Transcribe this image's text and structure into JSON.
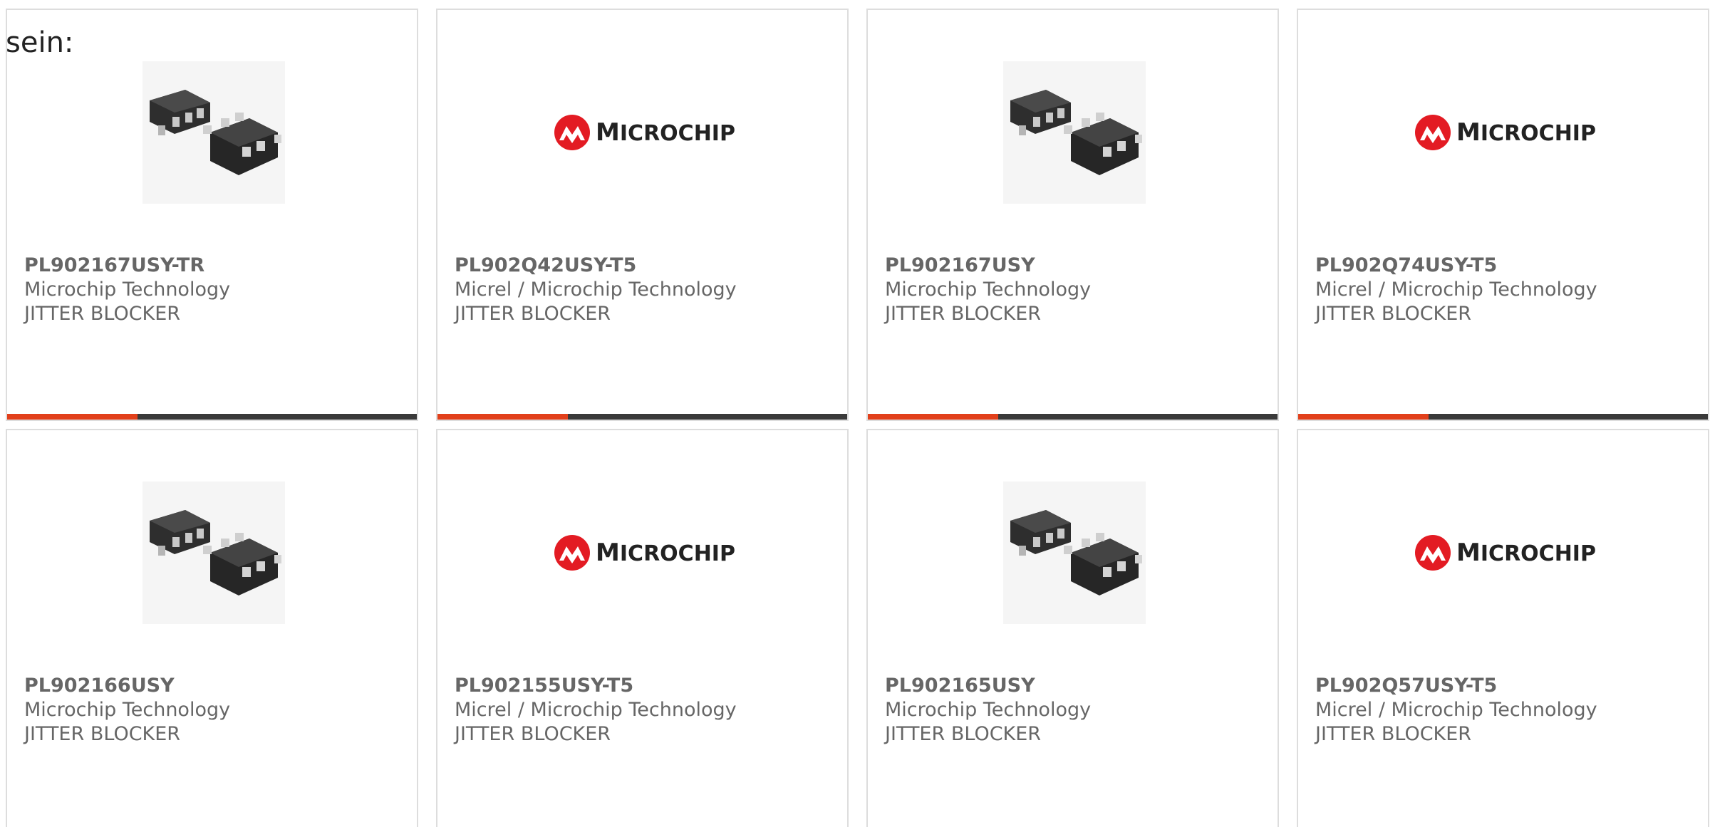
{
  "intro_text": "sein:",
  "colors": {
    "accent": "#e2401b",
    "bar": "#3a3a3a",
    "text": "#666666",
    "border": "#dddddd",
    "logo_red": "#e31b23"
  },
  "cards": [
    {
      "part": "PL902167USY-TR",
      "manufacturer": "Microchip Technology",
      "description": "JITTER BLOCKER",
      "image": "chip-photo"
    },
    {
      "part": "PL902Q42USY-T5",
      "manufacturer": "Micrel / Microchip Technology",
      "description": "JITTER BLOCKER",
      "image": "microchip-logo",
      "logo_text": "Microchip"
    },
    {
      "part": "PL902167USY",
      "manufacturer": "Microchip Technology",
      "description": "JITTER BLOCKER",
      "image": "chip-photo"
    },
    {
      "part": "PL902Q74USY-T5",
      "manufacturer": "Micrel / Microchip Technology",
      "description": "JITTER BLOCKER",
      "image": "microchip-logo",
      "logo_text": "Microchip"
    },
    {
      "part": "PL902166USY",
      "manufacturer": "Microchip Technology",
      "description": "JITTER BLOCKER",
      "image": "chip-photo"
    },
    {
      "part": "PL902155USY-T5",
      "manufacturer": "Micrel / Microchip Technology",
      "description": "JITTER BLOCKER",
      "image": "microchip-logo",
      "logo_text": "Microchip"
    },
    {
      "part": "PL902165USY",
      "manufacturer": "Microchip Technology",
      "description": "JITTER BLOCKER",
      "image": "chip-photo"
    },
    {
      "part": "PL902Q57USY-T5",
      "manufacturer": "Micrel / Microchip Technology",
      "description": "JITTER BLOCKER",
      "image": "microchip-logo",
      "logo_text": "Microchip"
    }
  ]
}
